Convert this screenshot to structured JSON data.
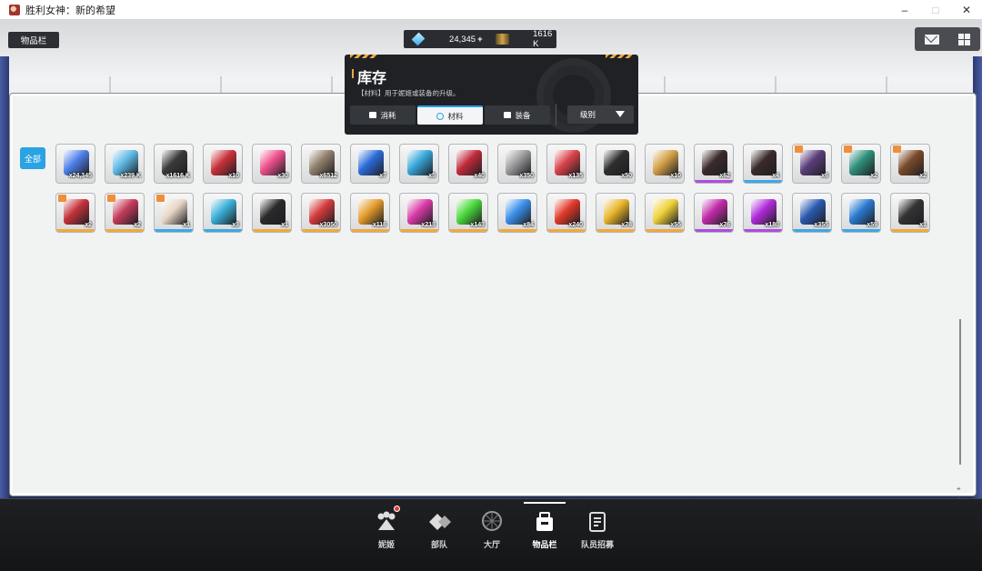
{
  "window": {
    "title": "胜利女神：新的希望",
    "controls": [
      "–",
      "□",
      "✕"
    ]
  },
  "page_tag": "物品栏",
  "currency": {
    "gems": "24,345",
    "gems_plus": "+",
    "credits": "1616 K"
  },
  "inventory": {
    "title": "库存",
    "subtitle": "【材料】用于妮姬或装备的升级。",
    "tabs": [
      {
        "label": "消耗",
        "icon": "box-icon",
        "active": false
      },
      {
        "label": "材料",
        "icon": "circle-icon",
        "active": true
      },
      {
        "label": "装备",
        "icon": "save-icon",
        "active": false
      }
    ],
    "sort_label": "级别",
    "filter_all": "全部"
  },
  "items": [
    {
      "qty": "x24,345",
      "color": "#4e7fe8",
      "rarity": "none",
      "gift": false
    },
    {
      "qty": "x239 K",
      "color": "#5fb9e6",
      "rarity": "none",
      "gift": false
    },
    {
      "qty": "x1616 K",
      "color": "#3a3a3a",
      "rarity": "none",
      "gift": false
    },
    {
      "qty": "x10",
      "color": "#c8313a",
      "rarity": "none",
      "gift": false
    },
    {
      "qty": "x30",
      "color": "#ee4f8c",
      "rarity": "none",
      "gift": false
    },
    {
      "qty": "x6512",
      "color": "#8f7f6a",
      "rarity": "none",
      "gift": false
    },
    {
      "qty": "x7",
      "color": "#2b6bd9",
      "rarity": "none",
      "gift": false
    },
    {
      "qty": "x5",
      "color": "#37a6d8",
      "rarity": "none",
      "gift": false
    },
    {
      "qty": "x40",
      "color": "#c02a3a",
      "rarity": "none",
      "gift": false
    },
    {
      "qty": "x350",
      "color": "#9a9a9a",
      "rarity": "none",
      "gift": false
    },
    {
      "qty": "x135",
      "color": "#d9414a",
      "rarity": "none",
      "gift": false
    },
    {
      "qty": "x50",
      "color": "#2e2e2e",
      "rarity": "none",
      "gift": false
    },
    {
      "qty": "x10",
      "color": "#d3a046",
      "rarity": "none",
      "gift": false
    },
    {
      "qty": "x62",
      "color": "#3a2a2a",
      "rarity": "purple",
      "gift": false
    },
    {
      "qty": "x4",
      "color": "#3a2a2a",
      "rarity": "blue",
      "gift": false
    },
    {
      "qty": "x6",
      "color": "#5a3e7a",
      "rarity": "none",
      "gift": true
    },
    {
      "qty": "x2",
      "color": "#2e8f7a",
      "rarity": "none",
      "gift": true
    },
    {
      "qty": "x2",
      "color": "#7a4a2a",
      "rarity": "none",
      "gift": true
    },
    {
      "qty": "x2",
      "color": "#c2313a",
      "rarity": "orange",
      "gift": true
    },
    {
      "qty": "x2",
      "color": "#c43a5a",
      "rarity": "orange",
      "gift": true
    },
    {
      "qty": "x1",
      "color": "#e8d6c6",
      "rarity": "blue",
      "gift": true
    },
    {
      "qty": "x3",
      "color": "#3ab0d8",
      "rarity": "blue",
      "gift": false
    },
    {
      "qty": "x1",
      "color": "#2a2a2a",
      "rarity": "orange",
      "gift": false
    },
    {
      "qty": "x3050",
      "color": "#d23a3a",
      "rarity": "orange",
      "gift": false
    },
    {
      "qty": "x118",
      "color": "#e39a2a",
      "rarity": "orange",
      "gift": false
    },
    {
      "qty": "x213",
      "color": "#d93aa8",
      "rarity": "orange",
      "gift": false
    },
    {
      "qty": "x143",
      "color": "#4ad83a",
      "rarity": "orange",
      "gift": false
    },
    {
      "qty": "x84",
      "color": "#3a8fe8",
      "rarity": "orange",
      "gift": false
    },
    {
      "qty": "x240",
      "color": "#e0392a",
      "rarity": "orange",
      "gift": false
    },
    {
      "qty": "x78",
      "color": "#e8b52a",
      "rarity": "orange",
      "gift": false
    },
    {
      "qty": "x55",
      "color": "#efd23a",
      "rarity": "orange",
      "gift": false
    },
    {
      "qty": "x76",
      "color": "#c02aa8",
      "rarity": "purple",
      "gift": false
    },
    {
      "qty": "x180",
      "color": "#b02ad8",
      "rarity": "purple",
      "gift": false
    },
    {
      "qty": "x355",
      "color": "#2a5ab0",
      "rarity": "blue",
      "gift": false
    },
    {
      "qty": "x59",
      "color": "#2a7ad0",
      "rarity": "blue",
      "gift": false
    },
    {
      "qty": "x1",
      "color": "#333333",
      "rarity": "orange",
      "gift": false
    }
  ],
  "nav": [
    {
      "label": "妮姬",
      "icon": "nikke-icon",
      "active": false,
      "badge": true
    },
    {
      "label": "部队",
      "icon": "squad-icon",
      "active": false,
      "badge": false
    },
    {
      "label": "大厅",
      "icon": "lobby-icon",
      "active": false,
      "badge": false
    },
    {
      "label": "物品栏",
      "icon": "inventory-icon",
      "active": true,
      "badge": false
    },
    {
      "label": "队员招募",
      "icon": "recruit-icon",
      "active": false,
      "badge": false
    }
  ]
}
